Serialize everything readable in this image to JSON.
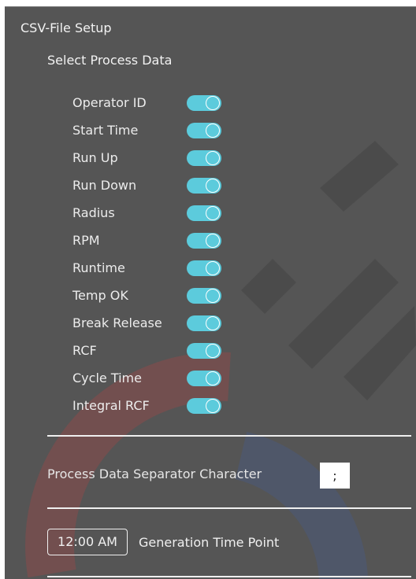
{
  "panel": {
    "title": "CSV-File Setup",
    "subtitle": "Select Process Data"
  },
  "process_data": [
    {
      "label": "Operator ID",
      "enabled": true
    },
    {
      "label": "Start Time",
      "enabled": true
    },
    {
      "label": "Run Up",
      "enabled": true
    },
    {
      "label": "Run Down",
      "enabled": true
    },
    {
      "label": "Radius",
      "enabled": true
    },
    {
      "label": "RPM",
      "enabled": true
    },
    {
      "label": "Runtime",
      "enabled": true
    },
    {
      "label": "Temp OK",
      "enabled": true
    },
    {
      "label": "Break Release",
      "enabled": true
    },
    {
      "label": "RCF",
      "enabled": true
    },
    {
      "label": "Cycle Time",
      "enabled": true
    },
    {
      "label": "Integral RCF",
      "enabled": true
    }
  ],
  "separator": {
    "label": "Process Data Separator Character",
    "value": ";"
  },
  "generation": {
    "time": "12:00 AM",
    "label": "Generation Time Point"
  },
  "colors": {
    "background": "#555555",
    "toggle_on": "#5ccbdc",
    "text": "#f2f2f2"
  }
}
